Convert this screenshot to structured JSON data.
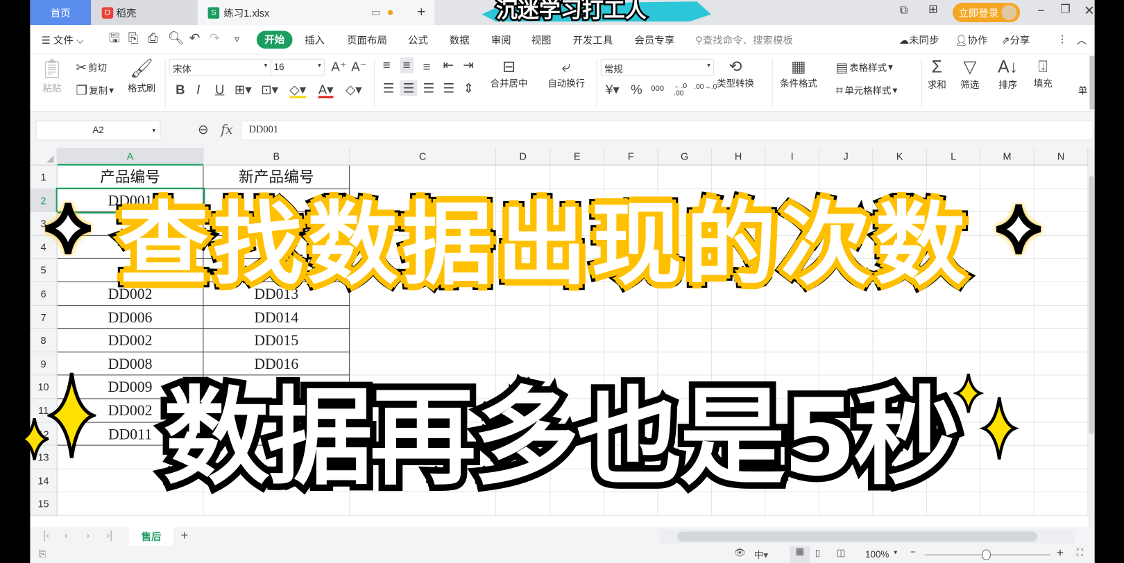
{
  "window_tabs": [
    {
      "label": "首页",
      "active": false
    },
    {
      "label": "稻壳"
    },
    {
      "label": "练习1.xlsx",
      "active": true
    }
  ],
  "banner_text": "沉迷学习打工人",
  "login_button": "立即登录",
  "menu": {
    "file": "文件",
    "tabs": [
      "开始",
      "插入",
      "页面布局",
      "公式",
      "数据",
      "审阅",
      "视图",
      "开发工具",
      "会员专享"
    ],
    "active_tab": "开始",
    "search_placeholder": "查找命令、搜索模板",
    "sync": "未同步",
    "collab": "协作",
    "share": "分享"
  },
  "ribbon": {
    "paste": "粘贴",
    "cut": "剪切",
    "copy": "复制",
    "format_painter": "格式刷",
    "font_name": "宋体",
    "font_size": "16",
    "merge": "合并居中",
    "wrap": "自动换行",
    "number_format": "常规",
    "convert": "类型转换",
    "cond_format": "条件格式",
    "table_style": "表格样式",
    "cell_style": "单元格样式",
    "sum": "求和",
    "filter": "筛选",
    "sort": "排序",
    "fill": "填充",
    "more": "单"
  },
  "formula_bar": {
    "name_box": "A2",
    "fx": "fx",
    "value": "DD001"
  },
  "columns": [
    "A",
    "B",
    "C",
    "D",
    "E",
    "F",
    "G",
    "H",
    "I",
    "J",
    "K",
    "L",
    "M",
    "N"
  ],
  "rows": [
    "1",
    "2",
    "3",
    "4",
    "5",
    "6",
    "7",
    "8",
    "9",
    "10",
    "11",
    "12",
    "13",
    "14",
    "15"
  ],
  "selected_cell": "A2",
  "cells": {
    "A": [
      "产品编号",
      "DD001",
      "",
      "",
      "",
      "DD002",
      "DD006",
      "DD002",
      "DD008",
      "DD009",
      "DD002",
      "DD011"
    ],
    "B": [
      "新产品编号",
      "",
      "",
      "",
      "DD012",
      "DD013",
      "DD014",
      "DD015",
      "DD016",
      "",
      "",
      ""
    ]
  },
  "sheet_tabs": [
    {
      "label": "售后",
      "active": true
    }
  ],
  "status": {
    "zoom": "100%"
  },
  "overlay": {
    "title": "查找数据出现的次数",
    "subtitle": "数据再多也是5秒"
  },
  "colors": {
    "accent": "#1a9e5f",
    "home_tab": "#5b8def",
    "login": "#f5a623",
    "title_glow": "#ffc000",
    "sparkle": "#ffe000"
  }
}
